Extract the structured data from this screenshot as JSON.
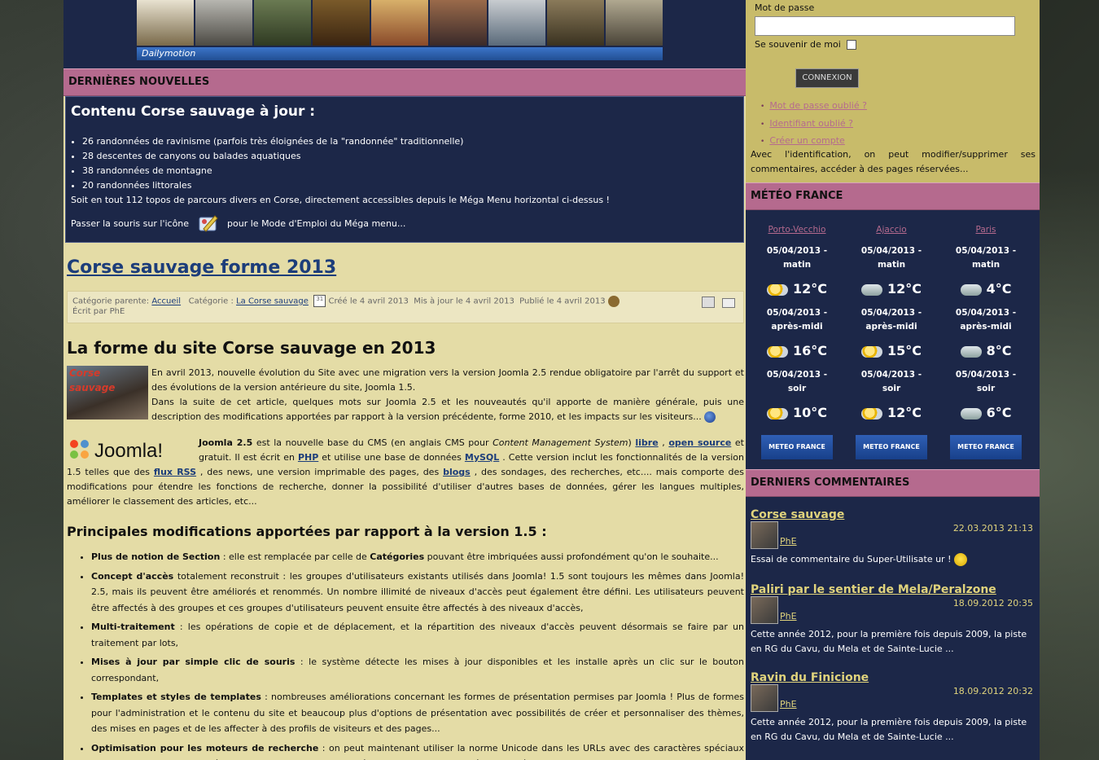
{
  "video": {
    "brand": "Dailymotion"
  },
  "news": {
    "section_title": "DERNIÈRES NOUVELLES",
    "heading": "Contenu Corse sauvage à jour :",
    "items": [
      "26 randonnées de ravinisme (parfois très éloignées de la \"randonnée\" traditionnelle)",
      "28 descentes de canyons ou balades aquatiques",
      "38 randonnées de montagne",
      "20 randonnées littorales"
    ],
    "summary": "Soit en tout 112 topos de parcours divers en Corse, directement accessibles depuis le Méga Menu horizontal ci-dessus !",
    "hover_before": "Passer la souris sur l'icône",
    "hover_after": "pour le Mode d'Emploi du Méga menu..."
  },
  "article": {
    "title": "Corse sauvage forme 2013",
    "meta_parent_label": "Catégorie parente:",
    "meta_parent": "Accueil",
    "meta_cat_label": "Catégorie :",
    "meta_cat": "La Corse sauvage",
    "meta_created": "Créé le 4 avril 2013",
    "meta_updated": "Mis à jour le 4 avril 2013",
    "meta_published": "Publié le 4 avril 2013",
    "meta_author": "Écrit par PhE",
    "subtitle": "La forme du site Corse sauvage en 2013",
    "img_caption": "Corse sauvage",
    "p1": "En avril 2013, nouvelle évolution du Site avec une migration vers la version Joomla 2.5 rendue obligatoire par l'arrêt du support et des évolutions de la version antérieure du site, Joomla 1.5.",
    "p2": "Dans la suite de cet article, quelques mots sur Joomla 2.5 et les nouveautés qu'il apporte de manière générale, puis une description des modifications apportées par rapport à la version précédente, forme 2010, et les impacts sur les visiteurs...",
    "joomla_logo": "Joomla!",
    "j_a": "Joomla 2.5",
    "j_b": " est la nouvelle base du CMS (en anglais CMS pour ",
    "j_c": "Content Management System",
    "j_d": ") ",
    "j_libre": "libre",
    "j_e": " , ",
    "j_os": "open source",
    "j_f": " et gratuit. Il est écrit en ",
    "j_php": "PHP",
    "j_g": "  et utilise une base de données ",
    "j_mysql": "MySQL",
    "j_h": " . Cette version inclut les fonctionnalités de la version 1.5 telles que des ",
    "j_rss": "flux RSS",
    "j_i": " , des news, une version imprimable des pages, des ",
    "j_blogs": "blogs",
    "j_j": " , des sondages, des recherches, etc.... mais comporte des modifications pour étendre les fonctions de recherche, donner la possibilité d'utiliser d'autres bases de données, gérer les langues multiples, améliorer le classement des articles, etc...",
    "changes_title": "Principales modifications apportées par rapport à la version 1.5 :",
    "changes": [
      {
        "b": "Plus de notion de Section",
        "t": " : elle est remplacée par celle de ",
        "b2": "Catégories",
        "t2": " pouvant être imbriquées aussi profondément qu'on le souhaite..."
      },
      {
        "b": "Concept d'accès",
        "t": " totalement reconstruit : les groupes d'utilisateurs existants utilisés dans Joomla! 1.5 sont toujours les mêmes dans Joomla! 2.5, mais ils peuvent être améliorés et renommés. Un nombre illimité de niveaux d'accès peut également être défini. Les utilisateurs peuvent être affectés à des groupes et ces groupes d'utilisateurs peuvent ensuite être affectés à des niveaux d'accès,",
        "b2": "",
        "t2": ""
      },
      {
        "b": "Multi-traitement",
        "t": " : les opérations de copie et de déplacement, et la répartition des niveaux d'accès peuvent désormais se faire par un traitement par lots,",
        "b2": "",
        "t2": ""
      },
      {
        "b": "Mises à jour par simple clic de souris",
        "t": " : le système détecte les mises à jour disponibles et les installe après un clic sur le bouton correspondant,",
        "b2": "",
        "t2": ""
      },
      {
        "b": "Templates et styles de templates",
        "t": " : nombreuses améliorations concernant les formes de présentation permises par Joomla ! Plus de formes pour l'administration et le contenu du site et beaucoup plus d'options de présentation avec possibilités de créer et personnaliser des thèmes, des mises en pages et de les affecter à des profils de visiteurs et des pages...",
        "b2": "",
        "t2": ""
      },
      {
        "b": "Optimisation pour les moteurs de recherche",
        "t": " : on peut maintenant utiliser la norme Unicode dans les URLs avec des caractères spéciaux (minuscules, majuscules, hébreu, arabe, ...), affecter des méta-textes et des mots-clés aux catégories, combiner le titre d'un site avec les titres de ses pages et décider de l'ordre de lisibilité ...",
        "b2": "",
        "t2": ""
      }
    ]
  },
  "login": {
    "password_label": "Mot de passe",
    "remember_label": "Se souvenir de moi",
    "button": "CONNEXION",
    "links": [
      "Mot de passe oublié ?",
      "Identifiant oublié ?",
      "Créer un compte"
    ],
    "info": "Avec l'identification, on peut modifier/supprimer ses commentaires, accéder à des pages réservées..."
  },
  "meteo": {
    "section_title": "MÉTÉO FRANCE",
    "badge": "METEO FRANCE",
    "cities": [
      {
        "name": "Porto-Vecchio",
        "slots": [
          {
            "date": "05/04/2013 -",
            "part": "matin",
            "temp": "12°C",
            "icon": "sun-cloud-icon"
          },
          {
            "date": "05/04/2013 -",
            "part": "après-midi",
            "temp": "16°C",
            "icon": "sun-cloud-icon"
          },
          {
            "date": "05/04/2013 -",
            "part": "soir",
            "temp": "10°C",
            "icon": "sun-cloud-icon"
          }
        ]
      },
      {
        "name": "Ajaccio",
        "slots": [
          {
            "date": "05/04/2013 -",
            "part": "matin",
            "temp": "12°C",
            "icon": "rain-cloud-icon"
          },
          {
            "date": "05/04/2013 -",
            "part": "après-midi",
            "temp": "15°C",
            "icon": "sun-cloud-icon"
          },
          {
            "date": "05/04/2013 -",
            "part": "soir",
            "temp": "12°C",
            "icon": "sun-cloud-icon"
          }
        ]
      },
      {
        "name": "Paris",
        "slots": [
          {
            "date": "05/04/2013 -",
            "part": "matin",
            "temp": "4°C",
            "icon": "cloud-icon"
          },
          {
            "date": "05/04/2013 -",
            "part": "après-midi",
            "temp": "8°C",
            "icon": "cloud-icon"
          },
          {
            "date": "05/04/2013 -",
            "part": "soir",
            "temp": "6°C",
            "icon": "cloud-icon"
          }
        ]
      }
    ]
  },
  "comments": {
    "section_title": "DERNIERS COMMENTAIRES",
    "items": [
      {
        "title": "Corse sauvage",
        "date": "22.03.2013 21:13",
        "user": "PhE",
        "text": "Essai de commentaire du Super-Utilisate ur !"
      },
      {
        "title": "Paliri par le sentier de Mela/Peralzone",
        "date": "18.09.2012 20:35",
        "user": "PhE",
        "text": "Cette année 2012, pour la première fois depuis 2009, la piste en RG du Cavu, du Mela et de Sainte-Lucie ..."
      },
      {
        "title": "Ravin du Finicione",
        "date": "18.09.2012 20:32",
        "user": "PhE",
        "text": "Cette année 2012, pour la première fois depuis 2009, la piste en RG du Cavu, du Mela et de Sainte-Lucie ..."
      }
    ]
  }
}
